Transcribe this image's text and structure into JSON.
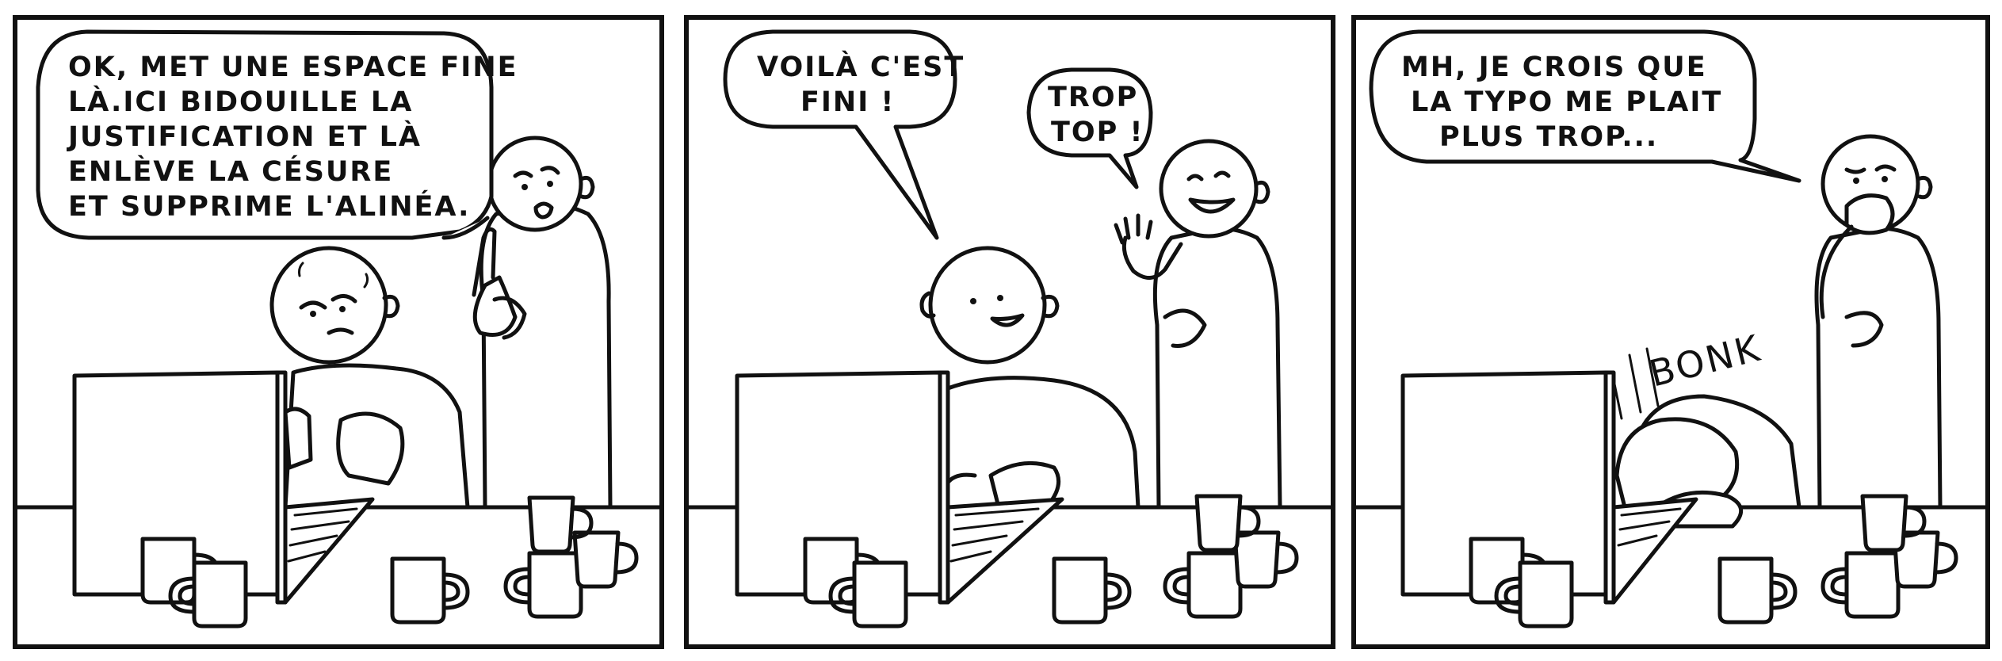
{
  "panels": [
    {
      "balloons": [
        {
          "lines": [
            "OK, MET UNE ESPACE FINE",
            "LÀ.ICI BIDOUILLE LA",
            "JUSTIFICATION ET LÀ",
            "ENLÈVE LA CÉSURE",
            "ET SUPPRIME L'ALINÉA."
          ]
        }
      ]
    },
    {
      "balloons": [
        {
          "lines": [
            "VOILÀ C'EST",
            "FINI !"
          ]
        },
        {
          "lines": [
            "TROP",
            "TOP !"
          ]
        }
      ]
    },
    {
      "balloons": [
        {
          "lines": [
            "MH, JE CROIS QUE",
            "LA TYPO ME PLAIT",
            "PLUS TROP..."
          ]
        }
      ],
      "sfx": "BONK"
    }
  ]
}
